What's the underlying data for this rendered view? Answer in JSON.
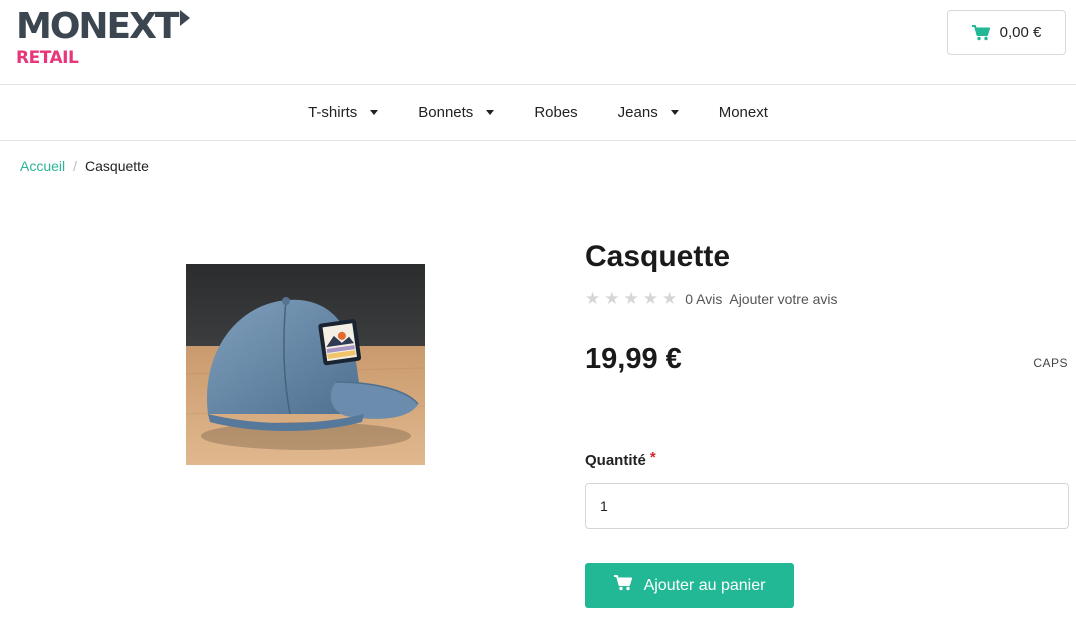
{
  "brand": {
    "name": "MONEXT",
    "sub": "RETAIL",
    "primary_color": "#3b4650",
    "accent_color": "#e8367a"
  },
  "header": {
    "cart_total": "0,00 €",
    "cart_icon": "cart-icon"
  },
  "nav": {
    "items": [
      {
        "label": "T-shirts",
        "has_dropdown": true
      },
      {
        "label": "Bonnets",
        "has_dropdown": true
      },
      {
        "label": "Robes",
        "has_dropdown": false
      },
      {
        "label": "Jeans",
        "has_dropdown": true
      },
      {
        "label": "Monext",
        "has_dropdown": false
      }
    ]
  },
  "breadcrumb": {
    "home": "Accueil",
    "separator": "/",
    "current": "Casquette"
  },
  "product": {
    "title": "Casquette",
    "rating": 0,
    "rating_max": 5,
    "review_count": "0 Avis",
    "add_review": "Ajouter votre avis",
    "price": "19,99 €",
    "sku": "CAPS",
    "quantity_label": "Quantité",
    "required_marker": "*",
    "quantity_value": "1",
    "add_to_cart": "Ajouter au panier",
    "button_color": "#22b896"
  }
}
